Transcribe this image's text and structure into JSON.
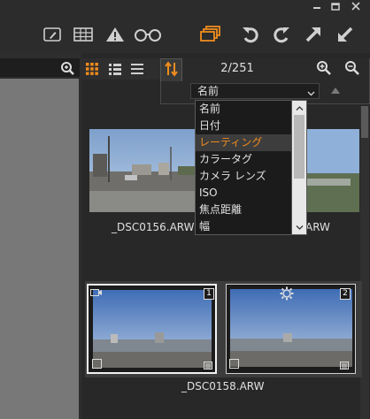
{
  "toolbar": {
    "icons": [
      "edit-icon",
      "grid-icon",
      "warning-icon",
      "glasses-icon",
      "stack-icon",
      "rotate-left-icon",
      "rotate-right-icon",
      "export-arrow-icon",
      "import-arrow-icon"
    ],
    "accent_color": "#f08c1e"
  },
  "browser": {
    "counter": "2/251",
    "sort": {
      "selected": "名前",
      "options": [
        "名前",
        "日付",
        "レーティング",
        "カラータグ",
        "カメラ レンズ",
        "ISO",
        "焦点距離",
        "幅"
      ],
      "highlighted_index": 2
    }
  },
  "thumbnails": {
    "row1_caption_left": "_DSC0156.ARW",
    "row1_caption_right": "ARW",
    "row2_caption": "_DSC0158.ARW",
    "card1_badge": "1",
    "card2_badge": "2"
  }
}
